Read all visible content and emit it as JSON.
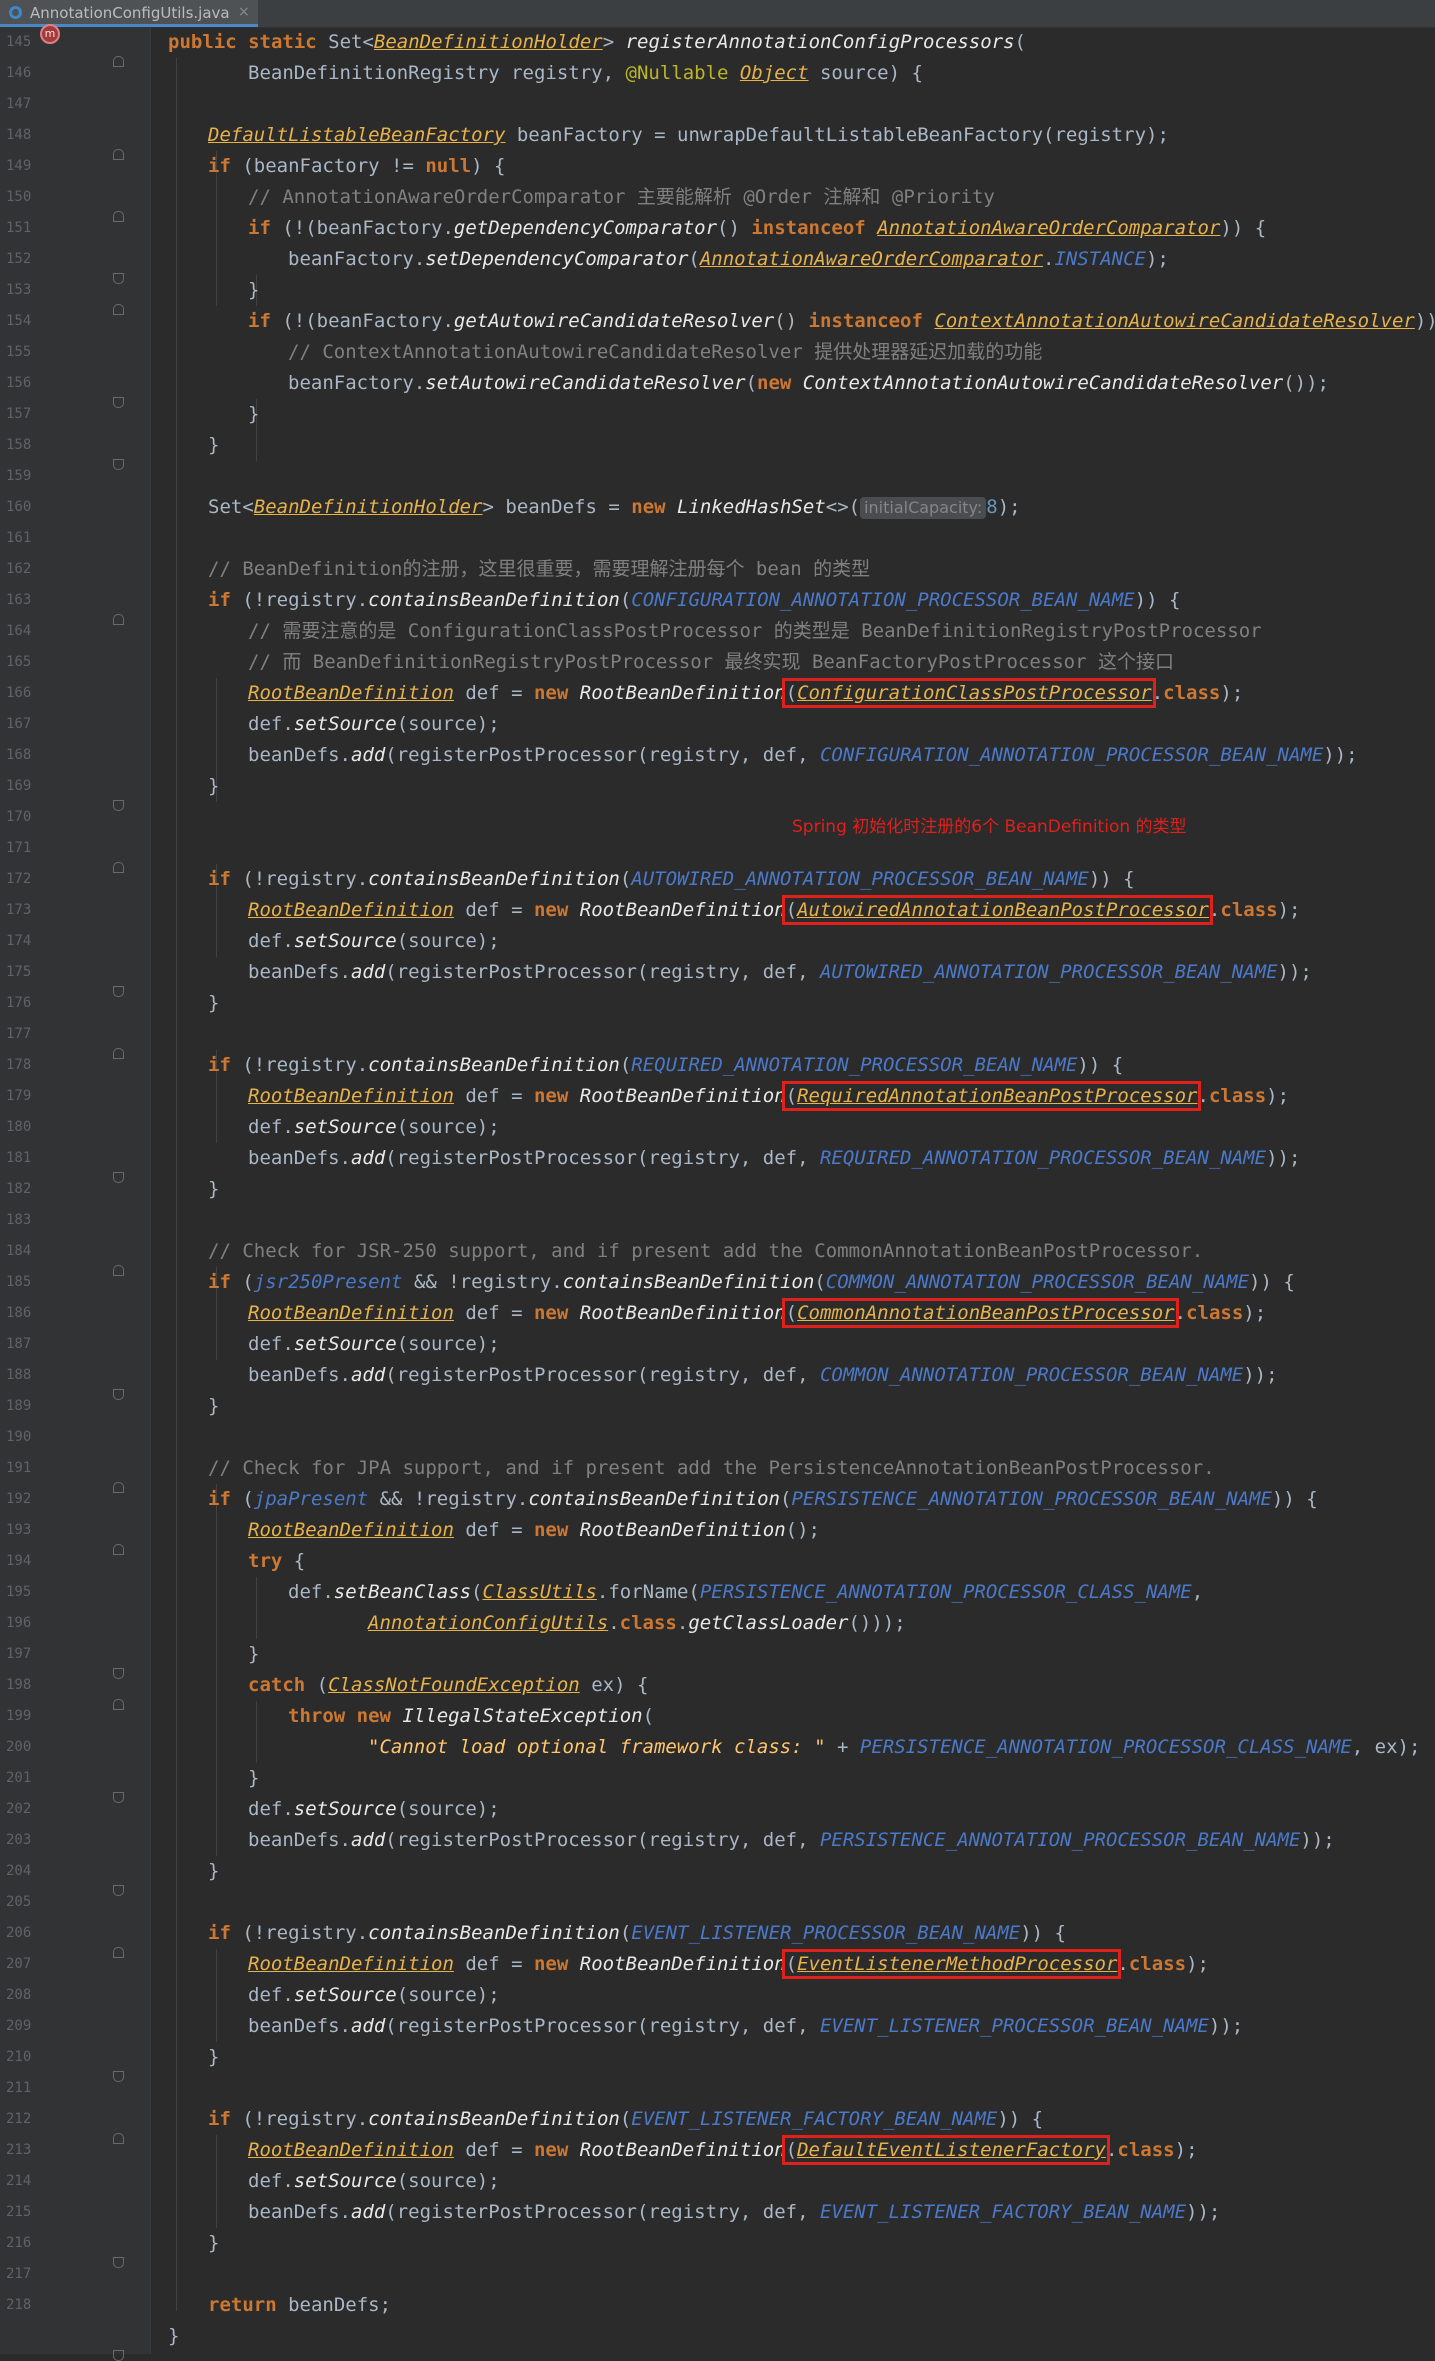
{
  "tab": {
    "file_name": "AnnotationConfigUtils.java",
    "close": "×"
  },
  "annotation_note": "Spring 初始化时注册的6个 BeanDefinition 的类型",
  "hint_label": "initialCapacity:",
  "line_numbers": [
    "145",
    "146",
    "147",
    "148",
    "149",
    "150",
    "151",
    "152",
    "153",
    "154",
    "155",
    "156",
    "157",
    "158",
    "159",
    "160",
    "161",
    "162",
    "163",
    "164",
    "165",
    "166",
    "167",
    "168",
    "169",
    "170",
    "171",
    "172",
    "173",
    "174",
    "175",
    "176",
    "177",
    "178",
    "179",
    "180",
    "181",
    "182",
    "183",
    "184",
    "185",
    "186",
    "187",
    "188",
    "189",
    "190",
    "191",
    "192",
    "193",
    "194",
    "195",
    "196",
    "197",
    "198",
    "199",
    "200",
    "201",
    "202",
    "203",
    "204",
    "205",
    "206",
    "207",
    "208",
    "209",
    "210",
    "211",
    "212",
    "213",
    "214",
    "215",
    "216",
    "217",
    "218"
  ],
  "code": {
    "boxed": {
      "configuration": "ConfigurationClassPostProcessor",
      "autowired": "AutowiredAnnotationBeanPostProcessor",
      "required": "RequiredAnnotationBeanPostProcessor",
      "common": "CommonAnnotationBeanPostProcessor",
      "event_method": "EventListenerMethodProcessor",
      "event_factory": "DefaultEventListenerFactory"
    }
  }
}
